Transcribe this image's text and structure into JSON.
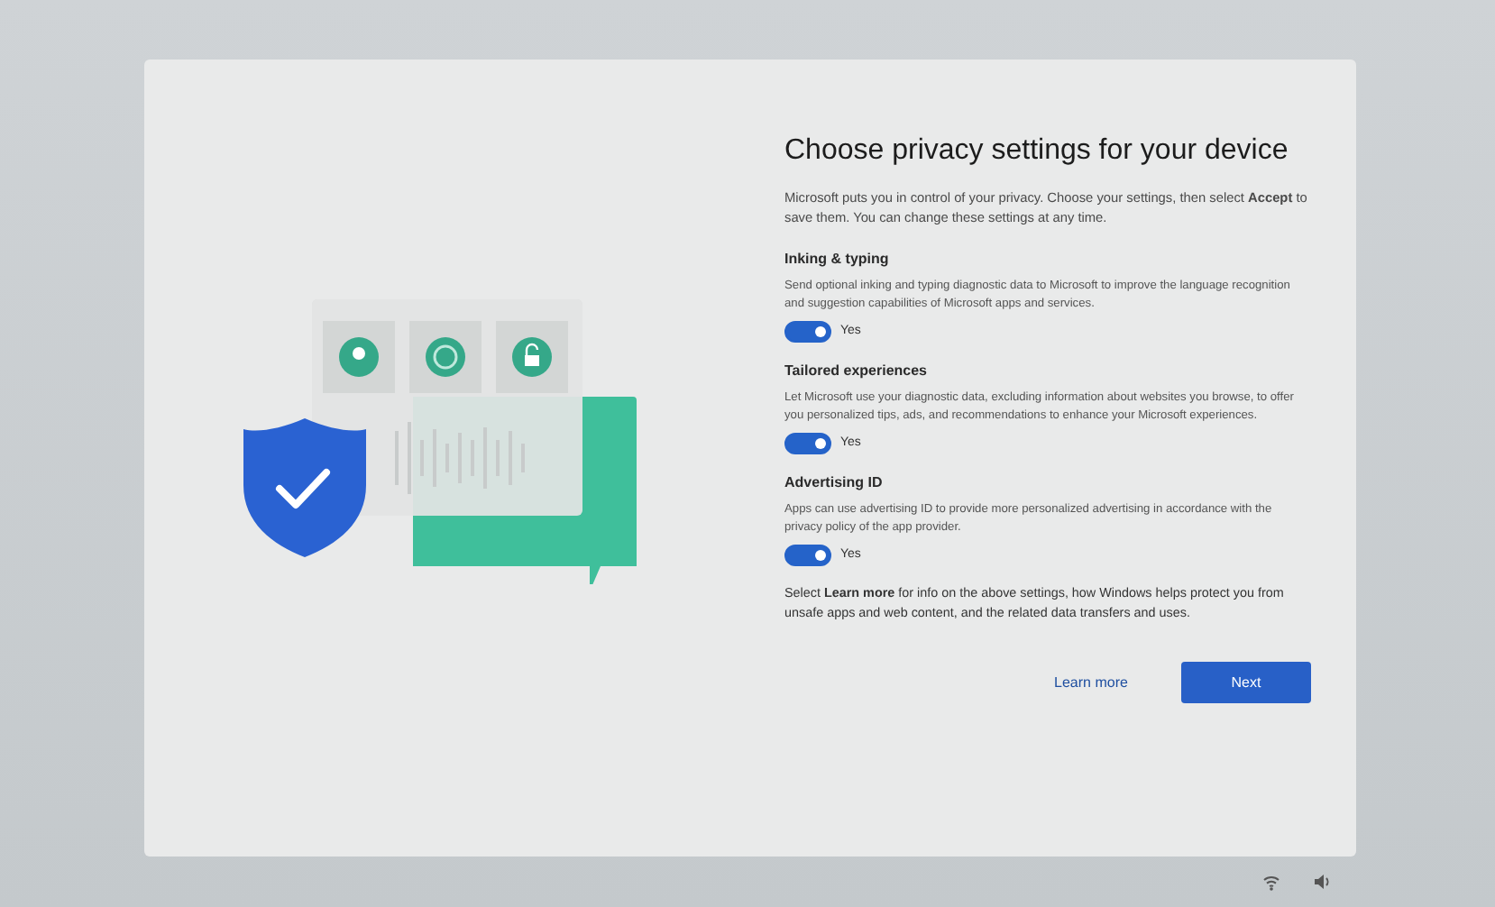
{
  "title": "Choose privacy settings for your device",
  "intro": "Microsoft puts you in control of your privacy. Choose your settings, then select **Accept** to save them. You can change these settings at any time.",
  "settings": [
    {
      "title": "Inking & typing",
      "description": "Send optional inking and typing diagnostic data to Microsoft to improve the language recognition and suggestion capabilities of Microsoft apps and services.",
      "on": true,
      "state_label": "Yes"
    },
    {
      "title": "Tailored experiences",
      "description": "Let Microsoft use your diagnostic data, excluding information about websites you browse, to offer you personalized tips, ads, and recommendations to enhance your Microsoft experiences.",
      "on": true,
      "state_label": "Yes"
    },
    {
      "title": "Advertising ID",
      "description": "Apps can use advertising ID to provide more personalized advertising in accordance with the privacy policy of the app provider.",
      "on": true,
      "state_label": "Yes"
    }
  ],
  "footer_note": "Select **Learn more** for info on the above settings, how Windows helps protect you from unsafe apps and web content, and the related data transfers and uses.",
  "buttons": [
    {
      "label": "Learn more",
      "kind": "link"
    },
    {
      "label": "Next",
      "kind": "primary"
    }
  ]
}
